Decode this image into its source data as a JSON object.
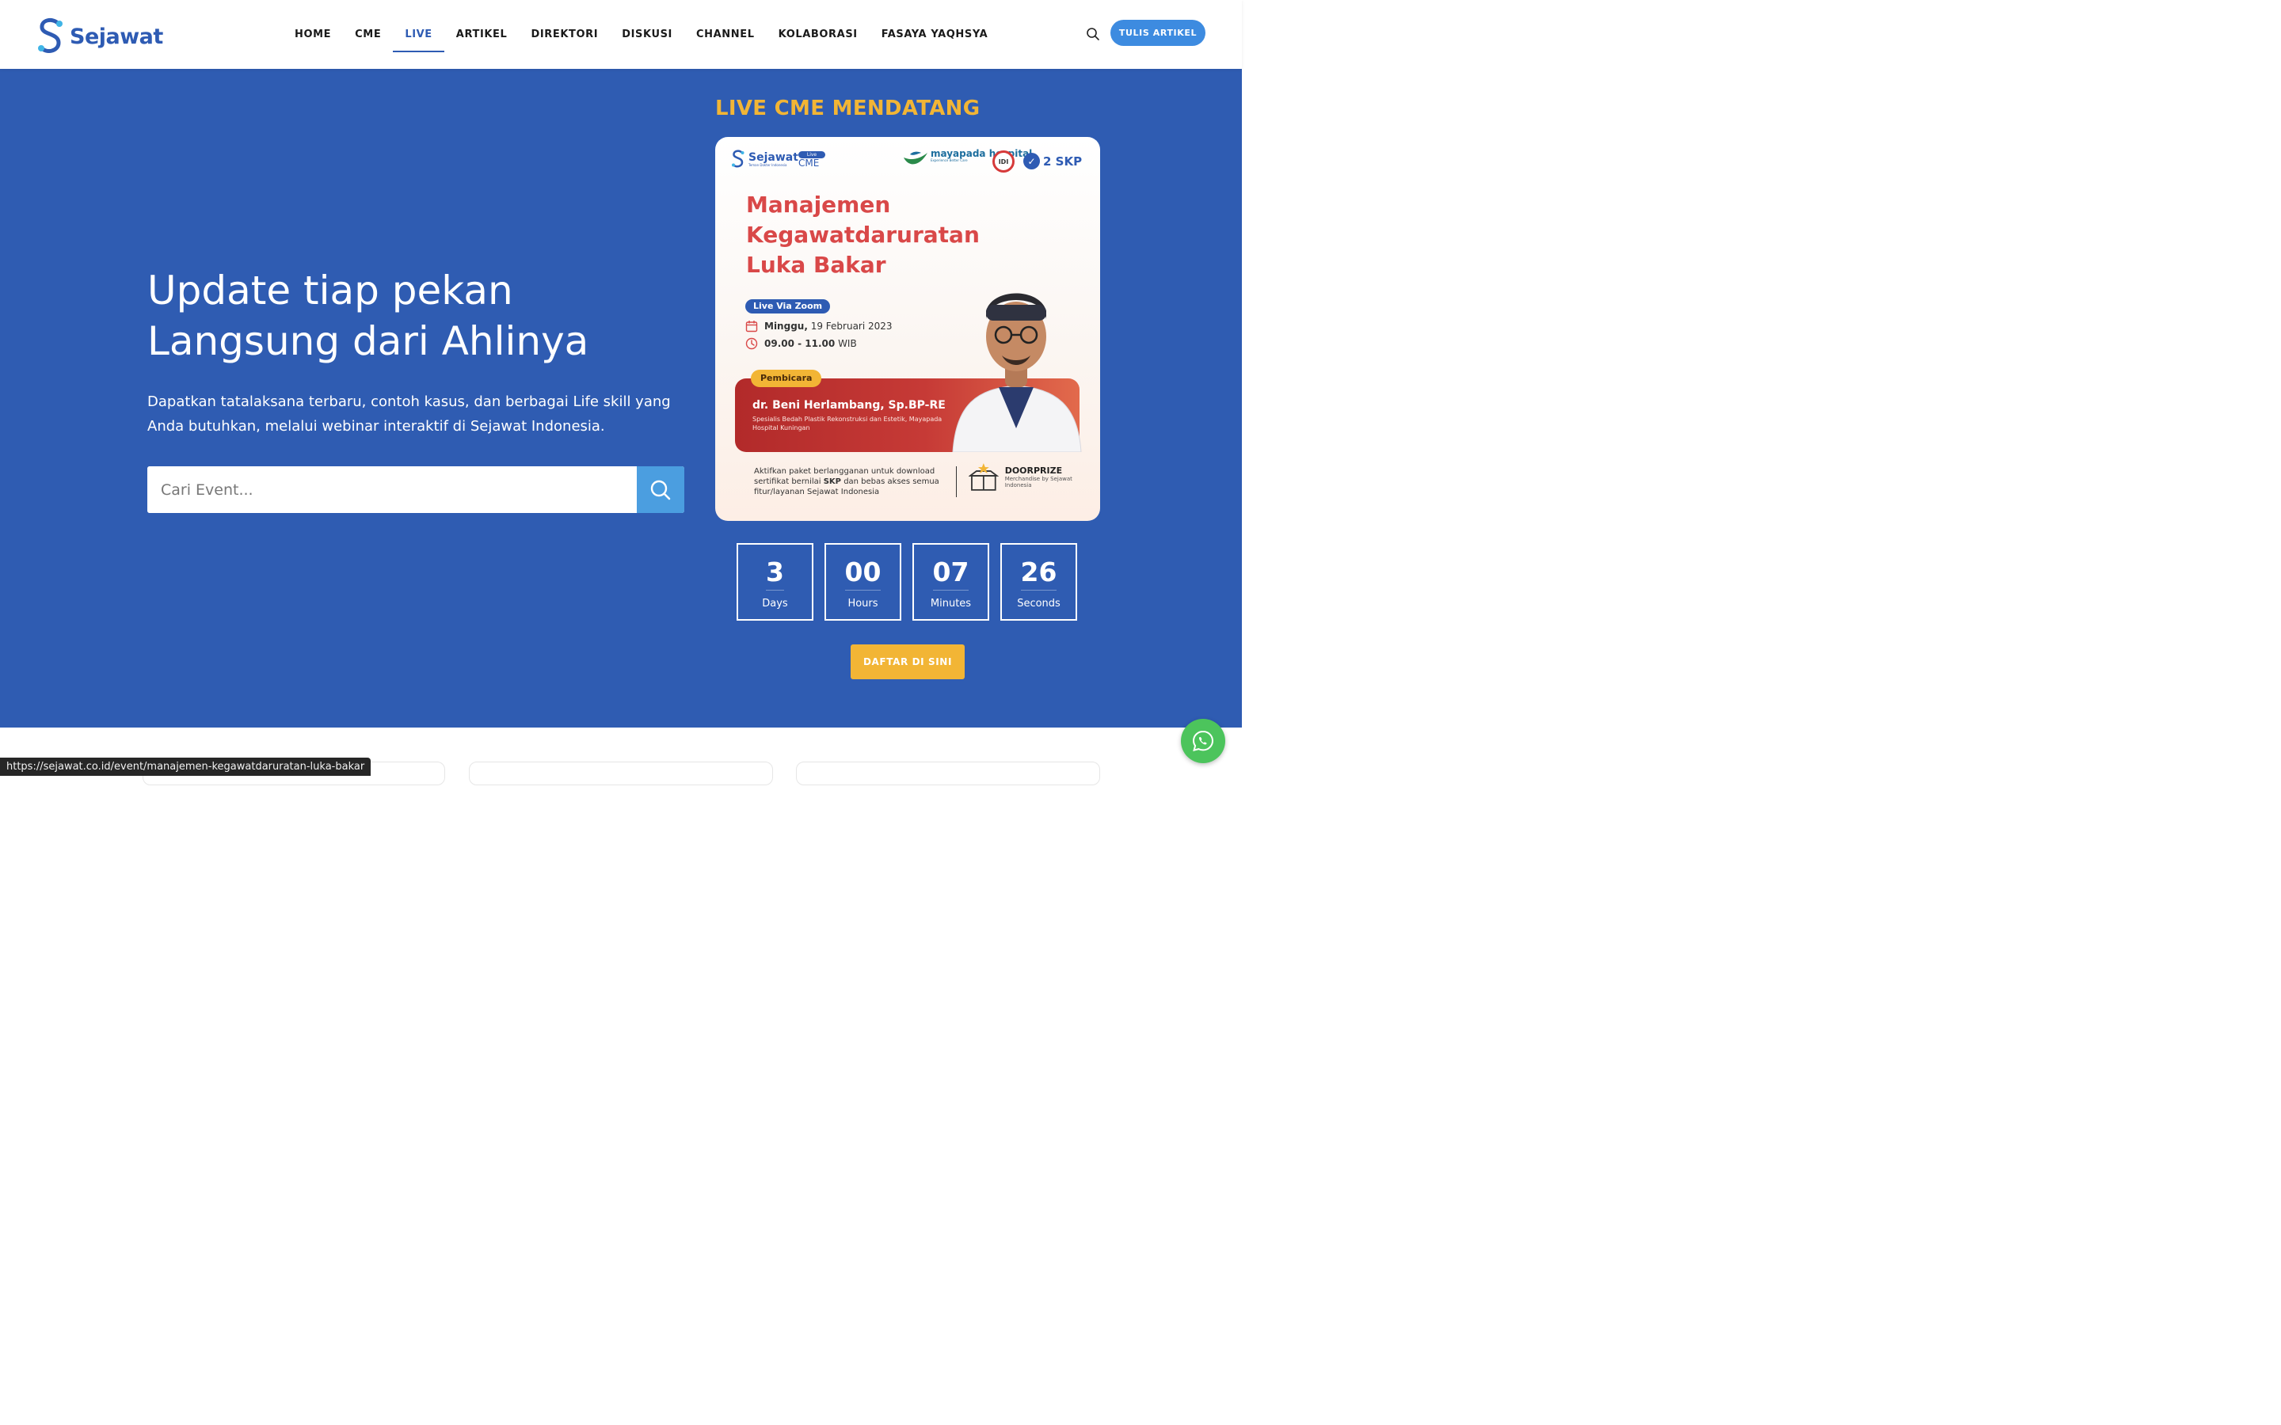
{
  "header": {
    "logo_text": "Sejawat",
    "nav": [
      {
        "label": "HOME",
        "active": false
      },
      {
        "label": "CME",
        "active": false
      },
      {
        "label": "LIVE",
        "active": true
      },
      {
        "label": "ARTIKEL",
        "active": false
      },
      {
        "label": "DIREKTORI",
        "active": false
      },
      {
        "label": "DISKUSI",
        "active": false
      },
      {
        "label": "CHANNEL",
        "active": false
      },
      {
        "label": "KOLABORASI",
        "active": false
      },
      {
        "label": "FASAYA YAQHSYA",
        "active": false
      }
    ],
    "search_icon": "search-icon",
    "write_button": "TULIS ARTIKEL"
  },
  "hero": {
    "title_line1": "Update tiap pekan",
    "title_line2": "Langsung dari Ahlinya",
    "description": "Dapatkan tatalaksana terbaru, contoh kasus, dan berbagai Life skill yang Anda butuhkan, melalui webinar interaktif di Sejawat Indonesia.",
    "search_placeholder": "Cari Event...",
    "search_value": ""
  },
  "upcoming": {
    "heading": "LIVE CME MENDATANG",
    "poster": {
      "brand": "Sejawat",
      "brand_sub": "Teman Dokter Indonesia",
      "live_badge": "Live",
      "cme_label": "CME",
      "partner": "mayapada hospital",
      "partner_sub": "Experience Better Care",
      "idi_label": "IDI",
      "skp_label": "2 SKP",
      "title_line1": "Manajemen",
      "title_line2": "Kegawatdaruratan",
      "title_line3": "Luka Bakar",
      "zoom_label": "Live Via Zoom",
      "date_bold": "Minggu,",
      "date_rest": " 19 Februari 2023",
      "time_bold": "09.00 - 11.00",
      "time_rest": " WIB",
      "speaker_pill": "Pembicara",
      "speaker_name": "dr. Beni Herlambang, Sp.BP-RE",
      "speaker_role": "Spesialis Bedah Plastik Rekonstruksi dan Estetik, Mayapada Hospital Kuningan",
      "footer_text_1": "Aktifkan paket berlangganan untuk download sertifikat bernilai ",
      "footer_text_bold": "SKP",
      "footer_text_2": " dan bebas akses semua fitur/layanan Sejawat Indonesia",
      "doorprize_title": "DOORPRIZE",
      "doorprize_sub": "Merchandise by Sejawat Indonesia"
    },
    "countdown": [
      {
        "value": "3",
        "label": "Days"
      },
      {
        "value": "00",
        "label": "Hours"
      },
      {
        "value": "07",
        "label": "Minutes"
      },
      {
        "value": "26",
        "label": "Seconds"
      }
    ],
    "register_button": "DAFTAR DI SINI"
  },
  "status_bar_url": "https://sejawat.co.id/event/manajemen-kegawatdaruratan-luka-bakar",
  "whatsapp_icon": "whatsapp-icon",
  "colors": {
    "primary_blue": "#2f5cb2",
    "accent_yellow": "#f2b535",
    "button_blue": "#3d8be0",
    "poster_red": "#d94848"
  }
}
